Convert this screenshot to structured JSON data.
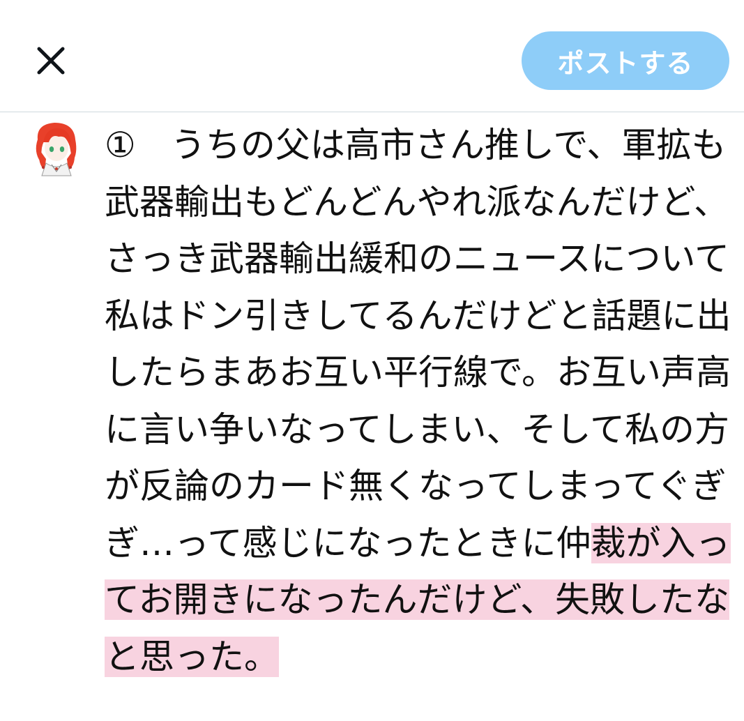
{
  "toolbar": {
    "post_label": "ポストする",
    "close_icon": "close-icon",
    "post_button_color": "#8ecdf8"
  },
  "composer": {
    "avatar_icon": "user-avatar",
    "text_plain": "①　うちの父は高市さん推しで、軍拡も武器輸出もどんどんやれ派なんだけど、さっき武器輸出緩和のニュースについて私はドン引きしてるんだけどと話題に出したらまあお互い平行線で。お互い声高に言い争いなってしまい、そして私の方が反論のカード無くなってしまってぐぎぎ…って感じになったときに仲",
    "text_highlighted": "裁が入ってお開きになったんだけど、失敗したなと思った。",
    "highlight_color": "#f8d3e0"
  }
}
